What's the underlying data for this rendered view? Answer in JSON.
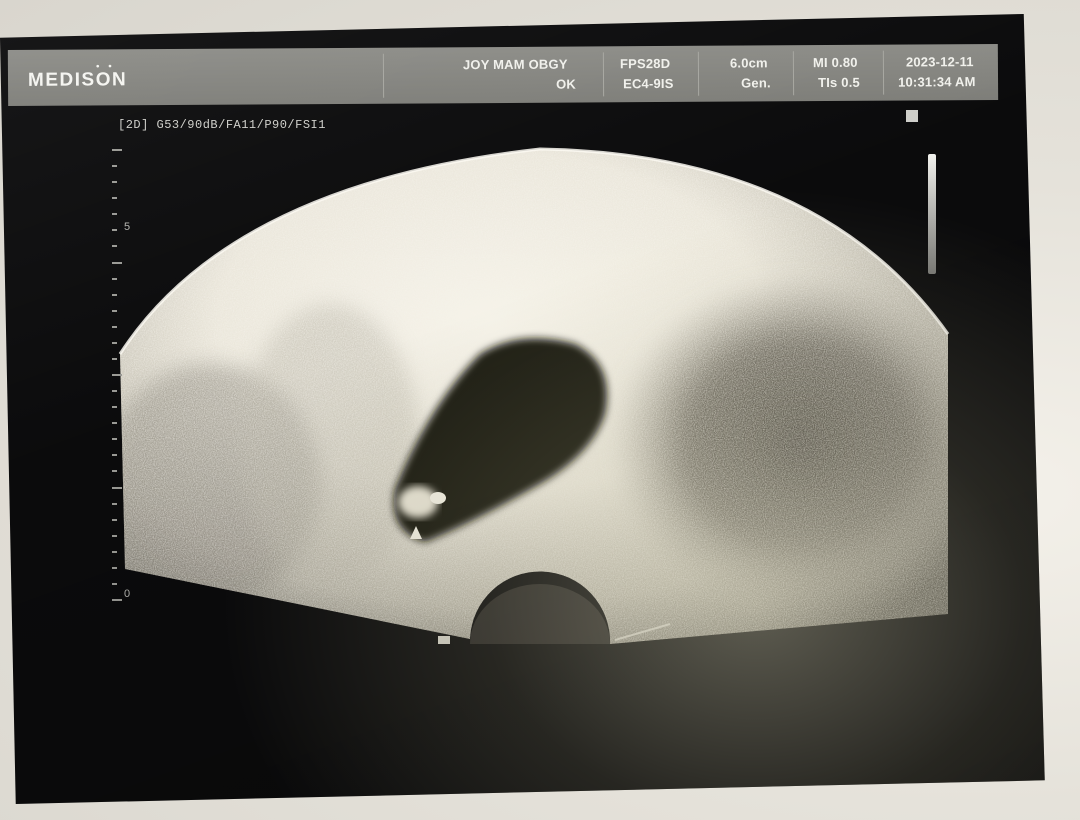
{
  "header": {
    "brand": "MEDISON",
    "institution_line1": "JOY MAM OBGY",
    "institution_line2": "OK",
    "frame_rate": "FPS28D",
    "probe": "EC4-9IS",
    "depth": "6.0cm",
    "mode": "Gen.",
    "mechanical_index": "MI 0.80",
    "thermal_index": "TIs 0.5",
    "date": "2023-12-11",
    "time": "10:31:34 AM"
  },
  "preset": "[2D] G53/90dB/FA11/P90/FSI1",
  "depth_scale": {
    "labels": [
      "5",
      "0"
    ]
  },
  "colors": {
    "printout_background": "#0b0b0c",
    "header_bar": "#8c8c87",
    "tissue_bright": "#f2efe4",
    "fluid_dark": "#141210"
  },
  "icons": {
    "brand_logo": "medison-logo",
    "grayscale_bar": "grayscale-bar-icon"
  }
}
